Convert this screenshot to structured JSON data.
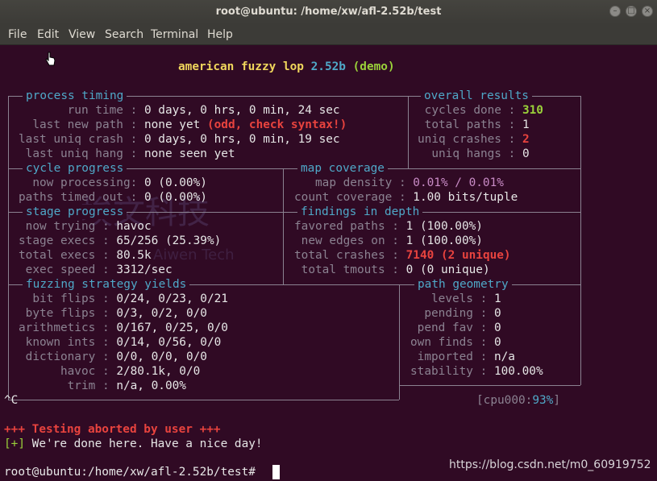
{
  "window": {
    "title": "root@ubuntu: /home/xw/afl-2.52b/test"
  },
  "menu": [
    "File",
    "Edit",
    "View",
    "Search",
    "Terminal",
    "Help"
  ],
  "banner": {
    "app": "american fuzzy lop",
    "version": "2.52b",
    "tag": "(demo)"
  },
  "process_timing": {
    "header": "process timing",
    "rows": [
      {
        "label": "       run time",
        "value": "0 days, 0 hrs, 0 min, 24 sec"
      },
      {
        "label": "  last new path",
        "value": "none yet ",
        "extra": "(odd, check syntax!)"
      },
      {
        "label": "last uniq crash",
        "value": "0 days, 0 hrs, 0 min, 19 sec"
      },
      {
        "label": " last uniq hang",
        "value": "none seen yet"
      }
    ]
  },
  "overall_results": {
    "header": "overall results",
    "rows": [
      {
        "label": "cycles done",
        "value": "310"
      },
      {
        "label": "total paths",
        "value": "1"
      },
      {
        "label": "uniq crashes",
        "value": "2"
      },
      {
        "label": "  uniq hangs",
        "value": "0"
      }
    ]
  },
  "cycle_progress": {
    "header": "cycle progress",
    "rows": [
      {
        "label": "  now processing",
        "value": "0 (0.00%)"
      },
      {
        "label": "paths timed out",
        "value": "0 (0.00%)"
      }
    ]
  },
  "map_coverage": {
    "header": "map coverage",
    "rows": [
      {
        "label": "   map density",
        "value": "0.01% / 0.01%"
      },
      {
        "label": "count coverage",
        "value": "1.00 bits/tuple"
      }
    ]
  },
  "stage_progress": {
    "header": "stage progress",
    "rows": [
      {
        "label": " now trying",
        "value": "havoc"
      },
      {
        "label": "stage execs",
        "value": "65/256 (25.39%)"
      },
      {
        "label": "total execs",
        "value": "80.5k"
      },
      {
        "label": " exec speed",
        "value": "3312/sec"
      }
    ]
  },
  "findings_in_depth": {
    "header": "findings in depth",
    "rows": [
      {
        "label": "favored paths",
        "value": "1 (100.00%)"
      },
      {
        "label": " new edges on",
        "value": "1 (100.00%)"
      },
      {
        "label": "total crashes",
        "value": "7140 (2 unique)"
      },
      {
        "label": " total tmouts",
        "value": "0 (0 unique)"
      }
    ]
  },
  "fuzzing_strategy_yields": {
    "header": "fuzzing strategy yields",
    "rows": [
      {
        "label": "  bit flips",
        "value": "0/24, 0/23, 0/21"
      },
      {
        "label": " byte flips",
        "value": "0/3, 0/2, 0/0"
      },
      {
        "label": "arithmetics",
        "value": "0/167, 0/25, 0/0"
      },
      {
        "label": " known ints",
        "value": "0/14, 0/56, 0/0"
      },
      {
        "label": " dictionary",
        "value": "0/0, 0/0, 0/0"
      },
      {
        "label": "      havoc",
        "value": "2/80.1k, 0/0"
      },
      {
        "label": "       trim",
        "value": "n/a, 0.00%"
      }
    ]
  },
  "path_geometry": {
    "header": "path geometry",
    "rows": [
      {
        "label": "   levels",
        "value": "1"
      },
      {
        "label": "  pending",
        "value": "0"
      },
      {
        "label": " pend fav",
        "value": "0"
      },
      {
        "label": "own finds",
        "value": "0"
      },
      {
        "label": " imported",
        "value": "n/a"
      },
      {
        "label": "stability",
        "value": "100.00%"
      }
    ]
  },
  "cpu": {
    "label": "[cpu000:",
    "value": "93%",
    "close": "]"
  },
  "ctrl_c": "^C",
  "aborted": "+++ Testing aborted by user +++",
  "done": {
    "tag": "[+]",
    "text": " We're done here. Have a nice day!"
  },
  "prompt": "root@ubuntu:/home/xw/afl-2.52b/test# ",
  "watermark": {
    "cn": "埃文科技",
    "en": "Aiwen Tech"
  },
  "footer_url": "https://blog.csdn.net/m0_60919752",
  "colors": {
    "terminal_bg": "#300a24",
    "label": "#8b8291",
    "accent": "#4fa8c8",
    "error": "#e8433e",
    "good": "#9ad13a",
    "title": "#f0d65c"
  }
}
